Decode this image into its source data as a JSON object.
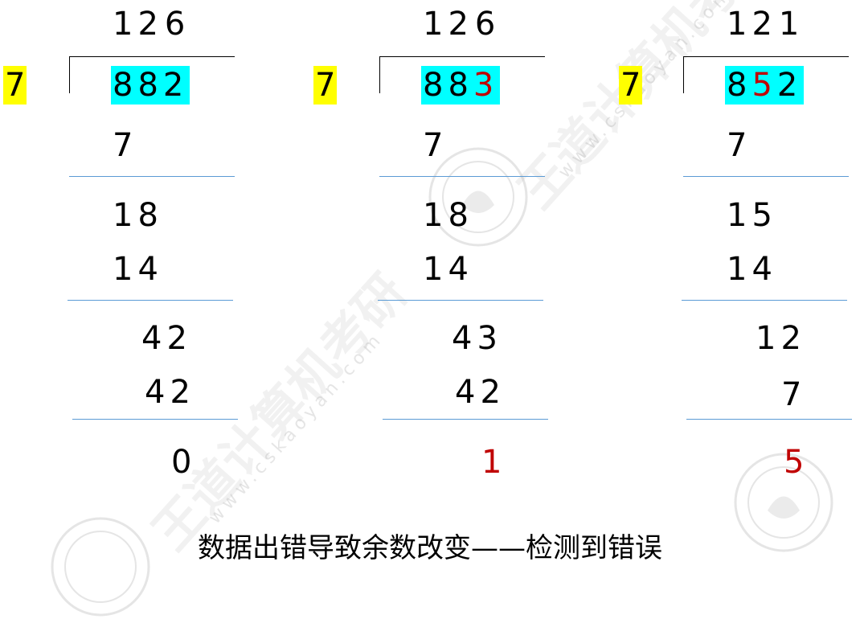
{
  "watermark": {
    "brand": "王道计算机考研",
    "url": "www.cskaoyan.com"
  },
  "panels": [
    {
      "quotient": [
        "1",
        "2",
        "6"
      ],
      "divisor": "7",
      "dividend": [
        {
          "d": "8",
          "err": false
        },
        {
          "d": "8",
          "err": false
        },
        {
          "d": "2",
          "err": false
        }
      ],
      "rows": [
        "7",
        "18",
        "14",
        "42",
        "42"
      ],
      "remainder": "0",
      "remainder_error": false
    },
    {
      "quotient": [
        "1",
        "2",
        "6"
      ],
      "divisor": "7",
      "dividend": [
        {
          "d": "8",
          "err": false
        },
        {
          "d": "8",
          "err": false
        },
        {
          "d": "3",
          "err": true
        }
      ],
      "rows": [
        "7",
        "18",
        "14",
        "43",
        "42"
      ],
      "remainder": "1",
      "remainder_error": true
    },
    {
      "quotient": [
        "1",
        "2",
        "1"
      ],
      "divisor": "7",
      "dividend": [
        {
          "d": "8",
          "err": false
        },
        {
          "d": "5",
          "err": true
        },
        {
          "d": "2",
          "err": false
        }
      ],
      "rows": [
        "7",
        "15",
        "14",
        "12",
        "7"
      ],
      "remainder": "5",
      "remainder_error": true
    }
  ],
  "caption": "数据出错导致余数改变——检测到错误",
  "colors": {
    "divisor_highlight": "#ffff00",
    "dividend_highlight": "#00ffff",
    "error_text": "#c00000",
    "rule": "#5b9bd5"
  }
}
